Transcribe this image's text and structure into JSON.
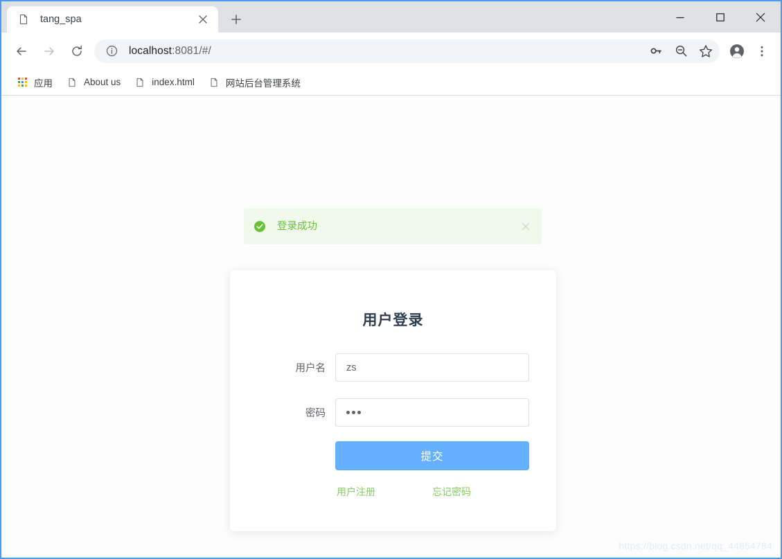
{
  "window": {
    "minimize_label": "Minimize",
    "maximize_label": "Maximize",
    "close_label": "Close"
  },
  "tabs": [
    {
      "title": "tang_spa",
      "favicon": "page-icon",
      "close_label": "×"
    }
  ],
  "newtab": {
    "label": "+"
  },
  "toolbar": {
    "back_label": "Back",
    "forward_label": "Forward",
    "reload_label": "Reload",
    "url_host": "localhost",
    "url_path": ":8081/#/",
    "url_full": "localhost:8081/#/",
    "site_info_icon": "info-circle-icon",
    "icons": [
      "key-icon",
      "zoom-out-icon",
      "star-icon",
      "profile-icon",
      "more-menu-icon"
    ]
  },
  "bookmarks": [
    {
      "label": "应用",
      "icon": "apps-grid-icon"
    },
    {
      "label": "About us",
      "icon": "page-icon"
    },
    {
      "label": "index.html",
      "icon": "page-icon"
    },
    {
      "label": "网站后台管理系统",
      "icon": "page-icon"
    }
  ],
  "alert": {
    "text": "登录成功",
    "icon": "success-check-circle-icon",
    "close_label": "×",
    "bg_color": "#f0f9eb",
    "text_color": "#67c23a"
  },
  "login": {
    "title": "用户登录",
    "fields": [
      {
        "label": "用户名",
        "value": "zs",
        "placeholder": "",
        "type": "text"
      },
      {
        "label": "密码",
        "value": "···",
        "placeholder": "",
        "type": "password",
        "dots": 3
      }
    ],
    "submit_label": "提交",
    "links": [
      {
        "label": "用户注册"
      },
      {
        "label": "忘记密码"
      }
    ],
    "accent_color": "#66b1ff",
    "link_color": "#85ce61"
  },
  "watermark": {
    "text": "https://blog.csdn.net/qq_44854784"
  }
}
